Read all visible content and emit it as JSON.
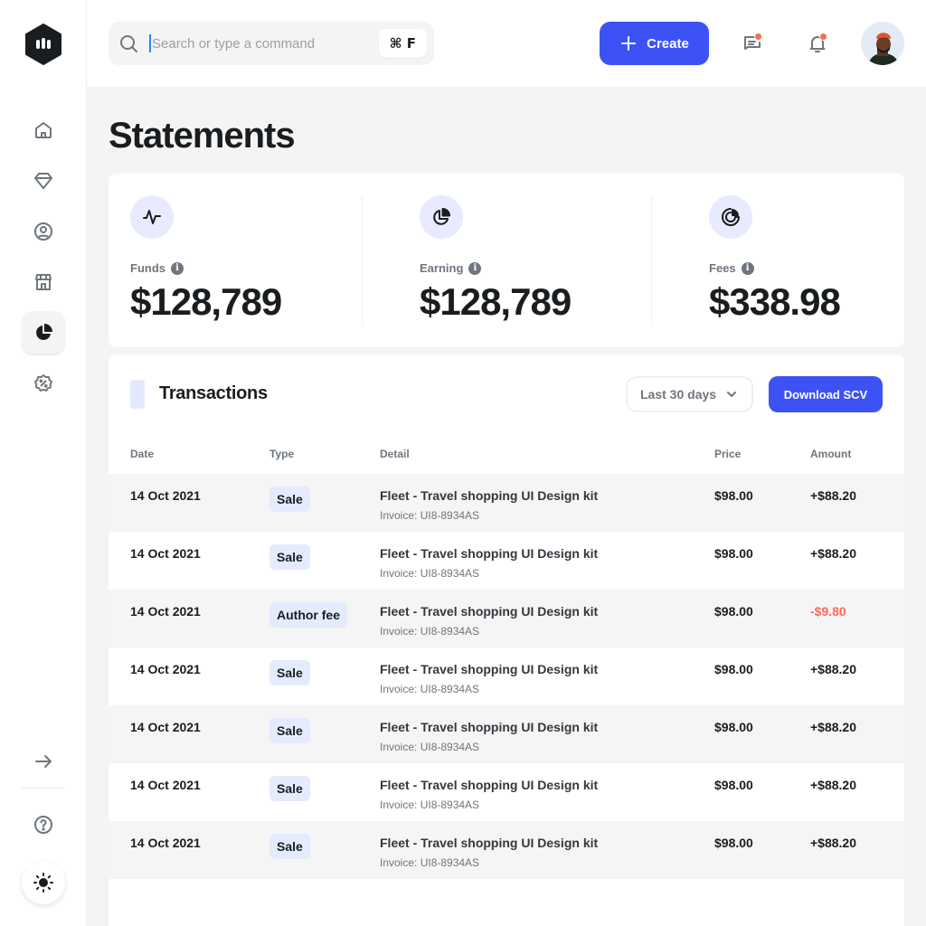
{
  "search": {
    "placeholder": "Search or type a command",
    "shortcut": "⌘ F"
  },
  "header": {
    "create_label": "Create"
  },
  "page": {
    "title": "Statements"
  },
  "stats": [
    {
      "label": "Funds",
      "value": "$128,789",
      "icon": "activity-icon"
    },
    {
      "label": "Earning",
      "value": "$128,789",
      "icon": "pie-chart-icon"
    },
    {
      "label": "Fees",
      "value": "$338.98",
      "icon": "donut-chart-icon"
    }
  ],
  "transactions": {
    "title": "Transactions",
    "range": "Last 30 days",
    "download_label": "Download SCV",
    "columns": [
      "Date",
      "Type",
      "Detail",
      "Price",
      "Amount"
    ],
    "rows": [
      {
        "date": "14 Oct 2021",
        "type": "Sale",
        "detail": "Fleet - Travel shopping UI Design kit",
        "invoice": "Invoice: UI8-8934AS",
        "price": "$98.00",
        "amount": "+$88.20"
      },
      {
        "date": "14 Oct 2021",
        "type": "Sale",
        "detail": "Fleet - Travel shopping UI Design kit",
        "invoice": "Invoice: UI8-8934AS",
        "price": "$98.00",
        "amount": "+$88.20"
      },
      {
        "date": "14 Oct 2021",
        "type": "Author fee",
        "detail": "Fleet - Travel shopping UI Design kit",
        "invoice": "Invoice: UI8-8934AS",
        "price": "$98.00",
        "amount": "-$9.80"
      },
      {
        "date": "14 Oct 2021",
        "type": "Sale",
        "detail": "Fleet - Travel shopping UI Design kit",
        "invoice": "Invoice: UI8-8934AS",
        "price": "$98.00",
        "amount": "+$88.20"
      },
      {
        "date": "14 Oct 2021",
        "type": "Sale",
        "detail": "Fleet - Travel shopping UI Design kit",
        "invoice": "Invoice: UI8-8934AS",
        "price": "$98.00",
        "amount": "+$88.20"
      },
      {
        "date": "14 Oct 2021",
        "type": "Sale",
        "detail": "Fleet - Travel shopping UI Design kit",
        "invoice": "Invoice: UI8-8934AS",
        "price": "$98.00",
        "amount": "+$88.20"
      },
      {
        "date": "14 Oct 2021",
        "type": "Sale",
        "detail": "Fleet - Travel shopping UI Design kit",
        "invoice": "Invoice: UI8-8934AS",
        "price": "$98.00",
        "amount": "+$88.20"
      }
    ]
  },
  "sidebar": {
    "items": [
      {
        "icon": "home-icon"
      },
      {
        "icon": "diamond-icon"
      },
      {
        "icon": "user-circle-icon"
      },
      {
        "icon": "store-icon"
      },
      {
        "icon": "pie-chart-icon",
        "active": true
      },
      {
        "icon": "discount-icon"
      }
    ],
    "bottom": [
      {
        "icon": "arrow-right-icon"
      },
      {
        "icon": "help-icon"
      },
      {
        "icon": "sun-icon"
      }
    ]
  },
  "colors": {
    "accent": "#3d52f4",
    "negative": "#ff6a55",
    "badge": "#e4ebfd",
    "row_alt": "#f5f5f5"
  }
}
